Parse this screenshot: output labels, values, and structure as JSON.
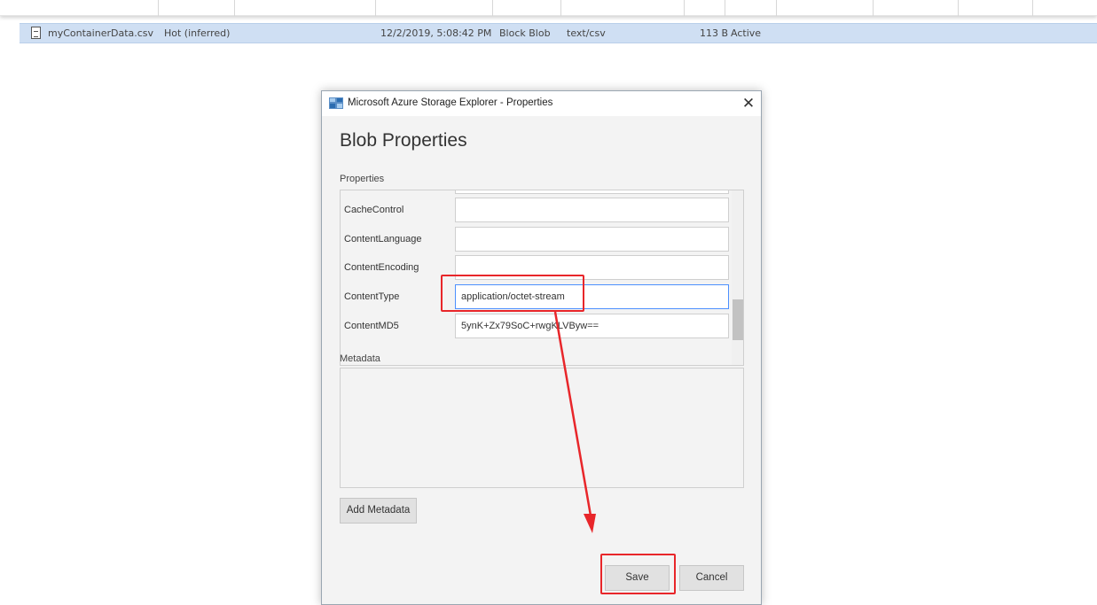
{
  "file_list": {
    "row": {
      "name": "myContainerData.csv",
      "access_tier": "Hot (inferred)",
      "modified": "12/2/2019, 5:08:42 PM",
      "blob_type": "Block Blob",
      "content_type": "text/csv",
      "size": "113 B",
      "status": "Active"
    }
  },
  "dialog": {
    "title": "Microsoft Azure Storage Explorer - Properties",
    "heading": "Blob Properties",
    "properties_label": "Properties",
    "properties": [
      {
        "label": "CacheControl",
        "value": ""
      },
      {
        "label": "ContentLanguage",
        "value": ""
      },
      {
        "label": "ContentEncoding",
        "value": ""
      },
      {
        "label": "ContentType",
        "value": "application/octet-stream"
      },
      {
        "label": "ContentMD5",
        "value": "5ynK+Zx79SoC+rwgKLVByw=="
      }
    ],
    "metadata_label": "Metadata",
    "add_metadata_label": "Add Metadata",
    "save_label": "Save",
    "cancel_label": "Cancel",
    "close_glyph": "✕"
  },
  "colors": {
    "selected_row": "#cfdff3",
    "annotation": "#e8262a",
    "dialog_bg": "#f3f3f3"
  },
  "icons": [
    "file-icon",
    "azure-storage-explorer-icon",
    "close-icon"
  ]
}
